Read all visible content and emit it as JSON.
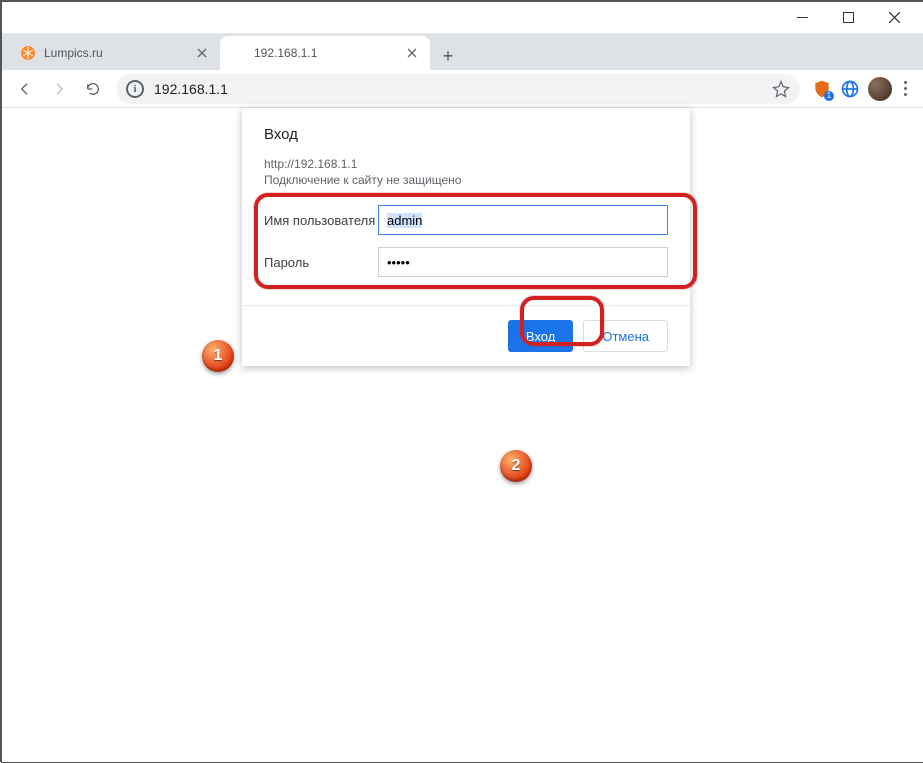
{
  "window": {
    "tabs": [
      {
        "label": "Lumpics.ru",
        "active": false
      },
      {
        "label": "192.168.1.1",
        "active": true
      }
    ],
    "address_url": "192.168.1.1",
    "ext_badge": "1"
  },
  "dialog": {
    "title": "Вход",
    "origin": "http://192.168.1.1",
    "warning": "Подключение к сайту не защищено",
    "username_label": "Имя пользователя",
    "username_value": "admin",
    "password_label": "Пароль",
    "password_value": "•••••",
    "login_button": "Вход",
    "cancel_button": "Отмена"
  },
  "annotations": {
    "marker1": "1",
    "marker2": "2"
  }
}
